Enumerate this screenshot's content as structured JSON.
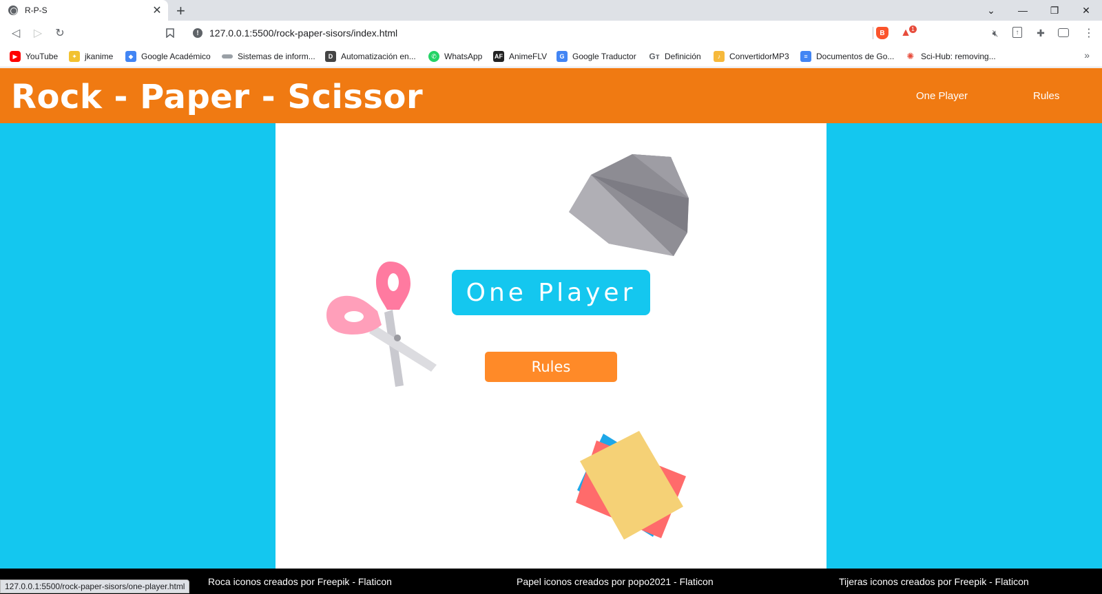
{
  "browser": {
    "tab_title": "R-P-S",
    "url": "127.0.0.1:5500/rock-paper-sisors/index.html",
    "status_url": "127.0.0.1:5500/rock-paper-sisors/one-player.html",
    "rewards_badge": "1",
    "bookmarks": [
      {
        "label": "YouTube",
        "icon": "youtube-icon",
        "color": "#ff0000"
      },
      {
        "label": "jkanime",
        "icon": "jkanime-icon",
        "color": "#f2c230"
      },
      {
        "label": "Google Académico",
        "icon": "google-scholar-icon",
        "color": "#4285f4"
      },
      {
        "label": "Sistemas de inform...",
        "icon": "page-icon",
        "color": "#9aa0a6"
      },
      {
        "label": "Automatización en...",
        "icon": "d-logo-icon",
        "color": "#444444"
      },
      {
        "label": "WhatsApp",
        "icon": "whatsapp-icon",
        "color": "#25d366"
      },
      {
        "label": "AnimeFLV",
        "icon": "animeflv-icon",
        "color": "#222222"
      },
      {
        "label": "Google Traductor",
        "icon": "google-translate-icon",
        "color": "#4285f4"
      },
      {
        "label": "Definición",
        "icon": "definition-icon",
        "color": "#5f6368"
      },
      {
        "label": "ConvertidorMP3",
        "icon": "convertidor-icon",
        "color": "#f6b93b"
      },
      {
        "label": "Documentos de Go...",
        "icon": "google-docs-icon",
        "color": "#4285f4"
      },
      {
        "label": "Sci-Hub: removing...",
        "icon": "scihub-icon",
        "color": "#e74c3c"
      }
    ]
  },
  "header": {
    "title": "Rock - Paper - Scissor",
    "nav": [
      "One Player",
      "Rules"
    ]
  },
  "main": {
    "one_player_label": "One Player",
    "rules_label": "Rules"
  },
  "footer": {
    "credits": [
      "Roca iconos creados por Freepik - Flaticon",
      "Papel iconos creados por popo2021 - Flaticon",
      "Tijeras iconos creados por Freepik - Flaticon"
    ]
  },
  "colors": {
    "header_orange": "#f07a12",
    "page_cyan": "#14c7ef",
    "rules_orange": "#ff8a28",
    "footer_black": "#000000"
  }
}
